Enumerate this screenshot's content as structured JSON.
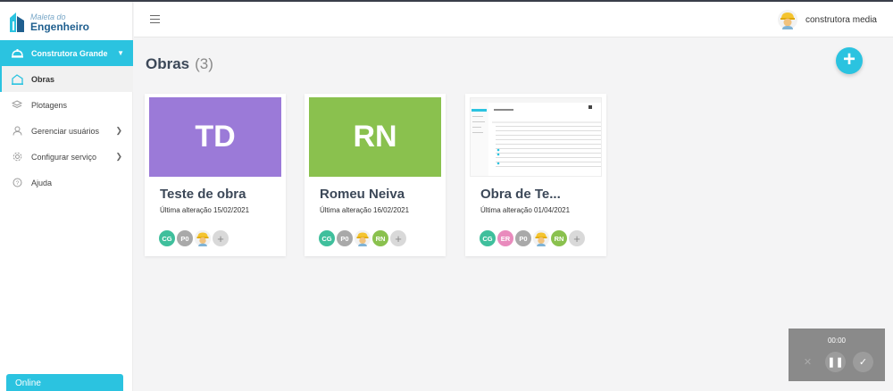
{
  "app": {
    "logo_line1": "Maleta do",
    "logo_line2": "Engenheiro"
  },
  "sidebar": {
    "company": "Construtora Grande",
    "items": [
      {
        "label": "Obras",
        "icon": "building-icon"
      },
      {
        "label": "Plotagens",
        "icon": "layers-icon"
      },
      {
        "label": "Gerenciar usuários",
        "icon": "user-icon"
      },
      {
        "label": "Configurar serviço",
        "icon": "gear-icon"
      },
      {
        "label": "Ajuda",
        "icon": "help-icon"
      }
    ],
    "status": "Online"
  },
  "header": {
    "user_name": "construtora media"
  },
  "main": {
    "title": "Obras",
    "count": "(3)",
    "add_symbol": "+"
  },
  "cards": [
    {
      "thumb_text": "TD",
      "thumb_color": "#9b7ad8",
      "title": "Teste de obra",
      "date": "Última alteração 15/02/2021",
      "members": [
        {
          "initials": "CG",
          "color": "#3fbf9c"
        },
        {
          "initials": "P0",
          "color": "#a9a9a9"
        },
        {
          "initials": "",
          "color": "#e8e8e8",
          "type": "photo"
        }
      ]
    },
    {
      "thumb_text": "RN",
      "thumb_color": "#8ac14e",
      "title": "Romeu Neiva",
      "date": "Última alteração 16/02/2021",
      "members": [
        {
          "initials": "CG",
          "color": "#3fbf9c"
        },
        {
          "initials": "P0",
          "color": "#a9a9a9"
        },
        {
          "initials": "",
          "color": "#e8e8e8",
          "type": "photo"
        },
        {
          "initials": "RN",
          "color": "#8ac14e"
        }
      ]
    },
    {
      "thumb_text": "",
      "thumb_color": "#ffffff",
      "title": "Obra de Te...",
      "date": "Última alteração 01/04/2021",
      "members": [
        {
          "initials": "CG",
          "color": "#3fbf9c"
        },
        {
          "initials": "ER",
          "color": "#e98bbd"
        },
        {
          "initials": "P0",
          "color": "#a9a9a9"
        },
        {
          "initials": "",
          "color": "#e8e8e8",
          "type": "photo"
        },
        {
          "initials": "RN",
          "color": "#8ac14e"
        }
      ]
    }
  ],
  "recorder": {
    "time": "00:00"
  },
  "colors": {
    "accent": "#2bc3e0",
    "sidebar_bg": "#ffffff",
    "page_bg": "#f4f4f5"
  }
}
